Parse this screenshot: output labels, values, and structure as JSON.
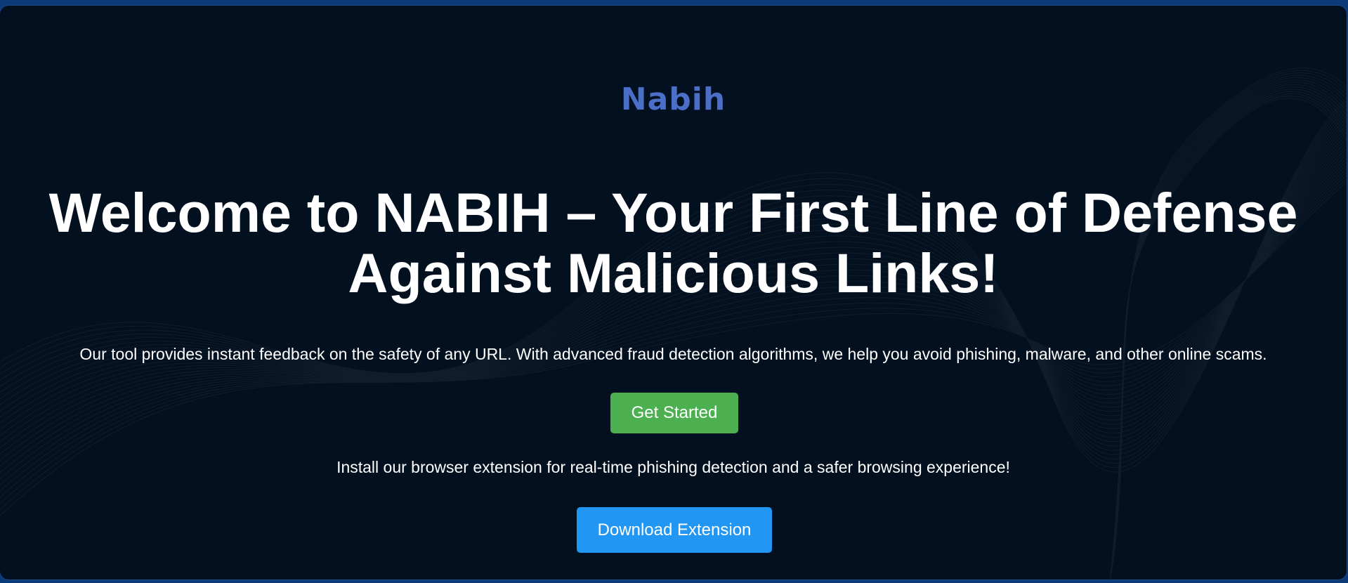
{
  "brand": {
    "logo_text": "Nabih",
    "logo_color": "#4b6fc9"
  },
  "hero": {
    "headline": "Welcome to NABIH – Your First Line of Defense Against Malicious Links!",
    "subtitle": "Our tool provides instant feedback on the safety of any URL. With advanced fraud detection algorithms, we help you avoid phishing, malware, and other online scams.",
    "get_started_label": "Get Started",
    "extension_text": "Install our browser extension for real-time phishing detection and a safer browsing experience!",
    "download_label": "Download Extension"
  },
  "colors": {
    "background": "#02101f",
    "outer_frame": "#0b3a78",
    "primary_button": "#4caf50",
    "secondary_button": "#2196f3",
    "text": "#ffffff"
  }
}
